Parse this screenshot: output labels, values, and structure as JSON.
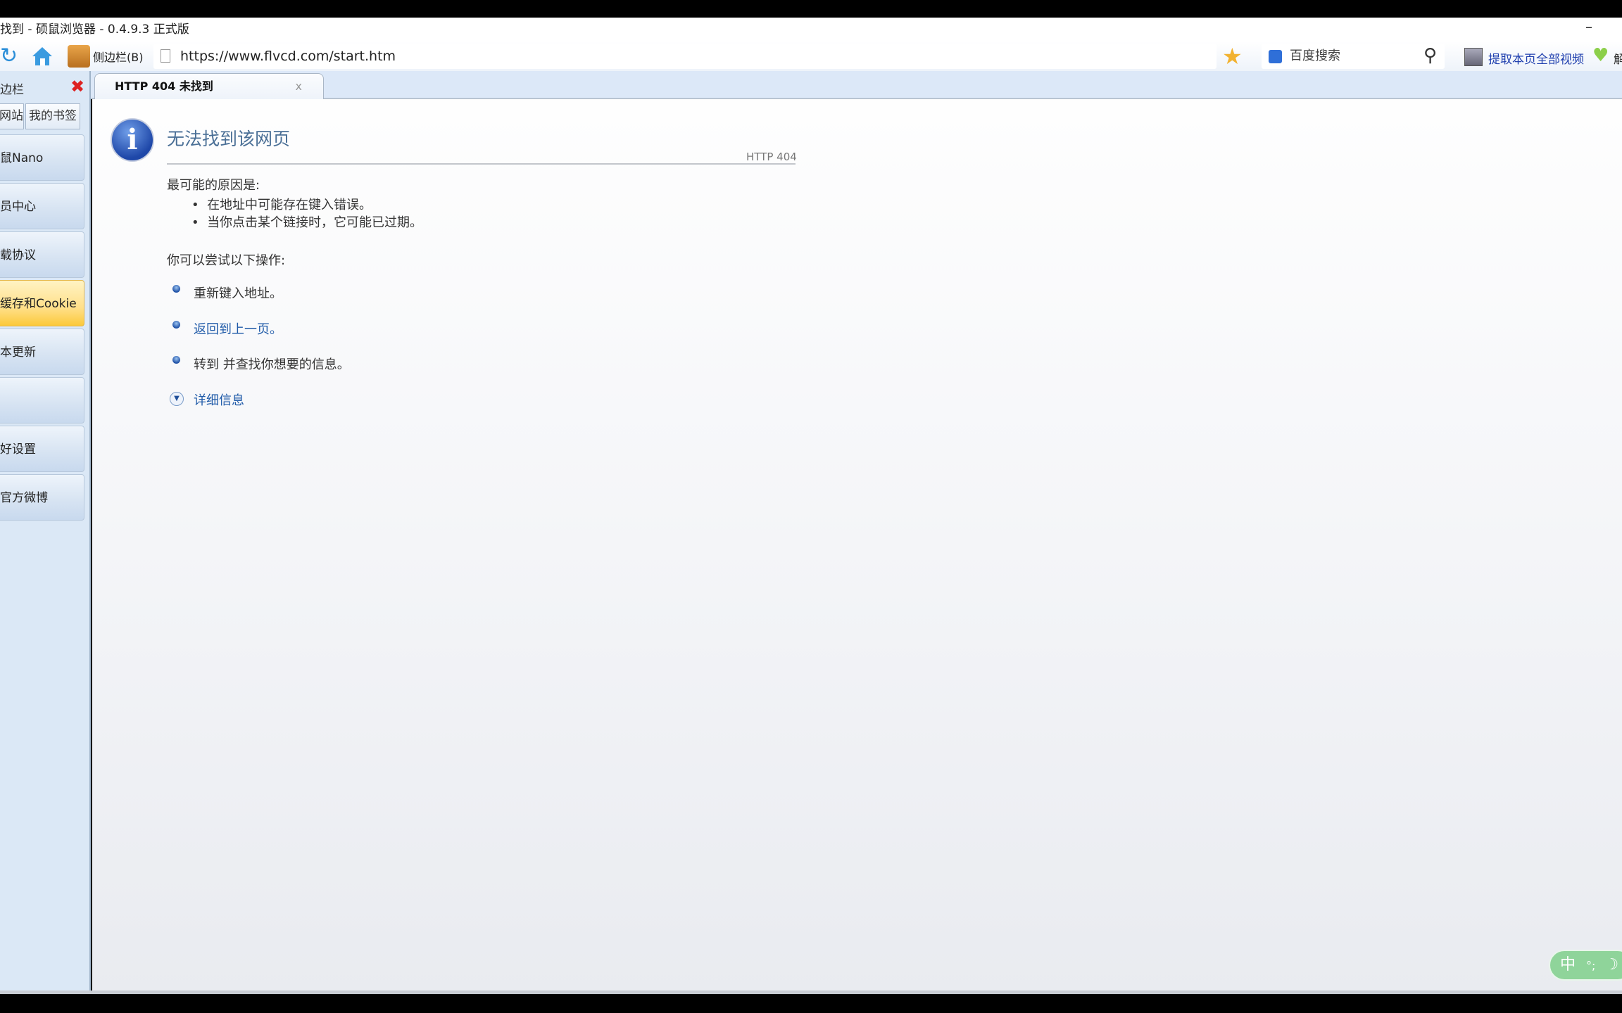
{
  "window": {
    "title": "找到 - 硕鼠浏览器 - 0.4.9.3 正式版",
    "minimize": "–"
  },
  "toolbar": {
    "sidebar_label": "侧边栏(B)",
    "url": "https://www.flvcd.com/start.htm",
    "search_placeholder": "百度搜索",
    "extract_label": "提取本页全部视频",
    "extra_label": "解"
  },
  "tab": {
    "title": "HTTP 404 未找到",
    "close": "x"
  },
  "sidebar": {
    "header": "边栏",
    "tabs": [
      "网站",
      "我的书签"
    ],
    "items": [
      {
        "label": "鼠Nano"
      },
      {
        "label": "员中心"
      },
      {
        "label": "载协议"
      },
      {
        "label": "缓存和Cookie",
        "active": true
      },
      {
        "label": "本更新"
      },
      {
        "label": ""
      },
      {
        "label": "好设置"
      },
      {
        "label": "官方微博"
      }
    ]
  },
  "page": {
    "title": "无法找到该网页",
    "code": "HTTP 404",
    "causes_heading": "最可能的原因是:",
    "causes": [
      "在地址中可能存在键入错误。",
      "当你点击某个链接时，它可能已过期。"
    ],
    "actions_heading": "你可以尝试以下操作:",
    "actions": [
      "重新键入地址。",
      "返回到上一页。",
      "转到  并查找你想要的信息。"
    ],
    "details": "详细信息"
  },
  "ime": {
    "mode": "中",
    "punct": "°;",
    "moon": "☽"
  }
}
